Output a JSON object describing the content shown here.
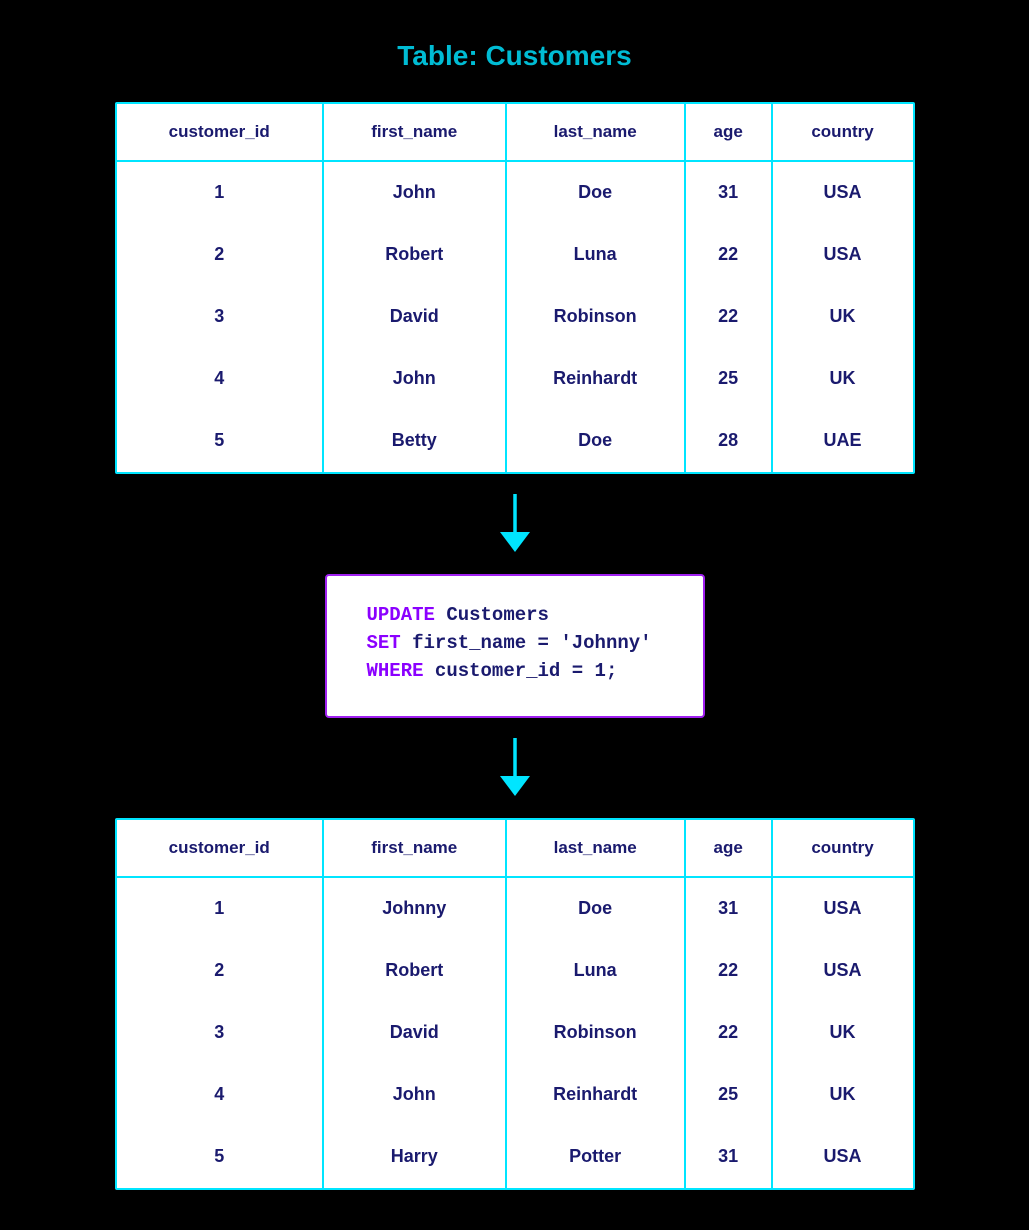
{
  "page": {
    "title": "Table: Customers",
    "background": "#000000"
  },
  "table_before": {
    "label": "before-table",
    "columns": [
      "customer_id",
      "first_name",
      "last_name",
      "age",
      "country"
    ],
    "rows": [
      {
        "customer_id": "1",
        "first_name": "John",
        "last_name": "Doe",
        "age": "31",
        "country": "USA"
      },
      {
        "customer_id": "2",
        "first_name": "Robert",
        "last_name": "Luna",
        "age": "22",
        "country": "USA"
      },
      {
        "customer_id": "3",
        "first_name": "David",
        "last_name": "Robinson",
        "age": "22",
        "country": "UK"
      },
      {
        "customer_id": "4",
        "first_name": "John",
        "last_name": "Reinhardt",
        "age": "25",
        "country": "UK"
      },
      {
        "customer_id": "5",
        "first_name": "Betty",
        "last_name": "Doe",
        "age": "28",
        "country": "UAE"
      }
    ]
  },
  "sql_query": {
    "line1_keyword": "UPDATE",
    "line1_rest": " Customers",
    "line2_keyword": "SET",
    "line2_rest": " first_name = 'Johnny'",
    "line3_keyword": "WHERE",
    "line3_rest": " customer_id = 1;"
  },
  "table_after": {
    "label": "after-table",
    "columns": [
      "customer_id",
      "first_name",
      "last_name",
      "age",
      "country"
    ],
    "rows": [
      {
        "customer_id": "1",
        "first_name": "Johnny",
        "last_name": "Doe",
        "age": "31",
        "country": "USA"
      },
      {
        "customer_id": "2",
        "first_name": "Robert",
        "last_name": "Luna",
        "age": "22",
        "country": "USA"
      },
      {
        "customer_id": "3",
        "first_name": "David",
        "last_name": "Robinson",
        "age": "22",
        "country": "UK"
      },
      {
        "customer_id": "4",
        "first_name": "John",
        "last_name": "Reinhardt",
        "age": "25",
        "country": "UK"
      },
      {
        "customer_id": "5",
        "first_name": "Harry",
        "last_name": "Potter",
        "age": "31",
        "country": "USA"
      }
    ]
  }
}
